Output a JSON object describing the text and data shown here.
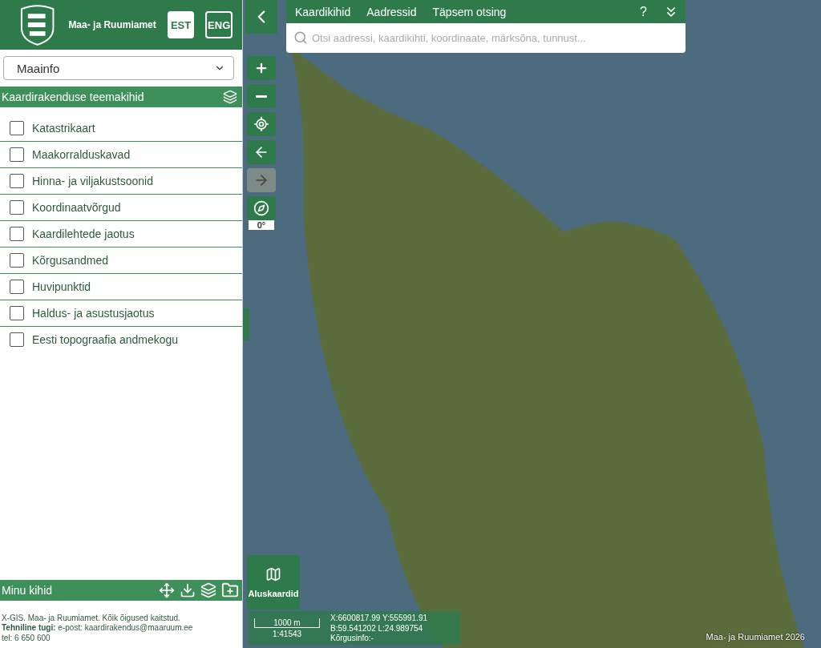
{
  "header": {
    "title": "Maa- ja Ruumiamet",
    "languages": [
      {
        "label": "EST",
        "selected": true
      },
      {
        "label": "ENG",
        "selected": false
      }
    ]
  },
  "theme_select": {
    "value": "Maainfo"
  },
  "layers_section": {
    "title": "Kaardirakenduse teemakihid",
    "items": [
      {
        "label": "Katastrikaart",
        "checked": false
      },
      {
        "label": "Maakorralduskavad",
        "checked": false
      },
      {
        "label": "Hinna- ja viljakustsoonid",
        "checked": false
      },
      {
        "label": "Koordinaatvõrgud",
        "checked": false
      },
      {
        "label": "Kaardilehtede jaotus",
        "checked": false
      },
      {
        "label": "Kõrgusandmed",
        "checked": false
      },
      {
        "label": "Huvipunktid",
        "checked": false
      },
      {
        "label": "Haldus- ja asustusjaotus",
        "checked": false
      },
      {
        "label": "Eesti topograafia andmekogu",
        "checked": false
      }
    ]
  },
  "my_layers": {
    "title": "Minu kihid"
  },
  "footer": {
    "lines": [
      "X-GIS. Maa- ja Ruumiamet. Kõik õigused kaitstud.",
      "**Tehniline tugi:** e-post: kaardirakendus@maaruum.ee",
      "tel: 6 650 600"
    ]
  },
  "search_panel": {
    "tabs": [
      "Kaardikihid",
      "Aadressid",
      "Täpsem otsing"
    ],
    "help_label": "?",
    "placeholder": "Otsi aadressi, kaardikihti, koordinaate, märksõna, tunnust..."
  },
  "map_controls": {
    "buttons": [
      {
        "kind": "zoom-in",
        "disabled": false
      },
      {
        "kind": "zoom-out",
        "disabled": false
      },
      {
        "kind": "locate",
        "disabled": false
      },
      {
        "kind": "back",
        "disabled": false
      },
      {
        "kind": "forward",
        "disabled": true
      },
      {
        "kind": "compass",
        "disabled": false
      }
    ],
    "rotation": "0°"
  },
  "basemap_button": {
    "label": "Aluskaardid"
  },
  "scale": {
    "distance": "1000 m",
    "ratio": "1:41543"
  },
  "coordinates": {
    "lines": [
      "X:6600817.99 Y:555991.91",
      "B:59.541202 L:24.989754",
      "Kõrgusinfo:-"
    ]
  },
  "attribution": "Maa- ja Ruumiamet 2026"
}
